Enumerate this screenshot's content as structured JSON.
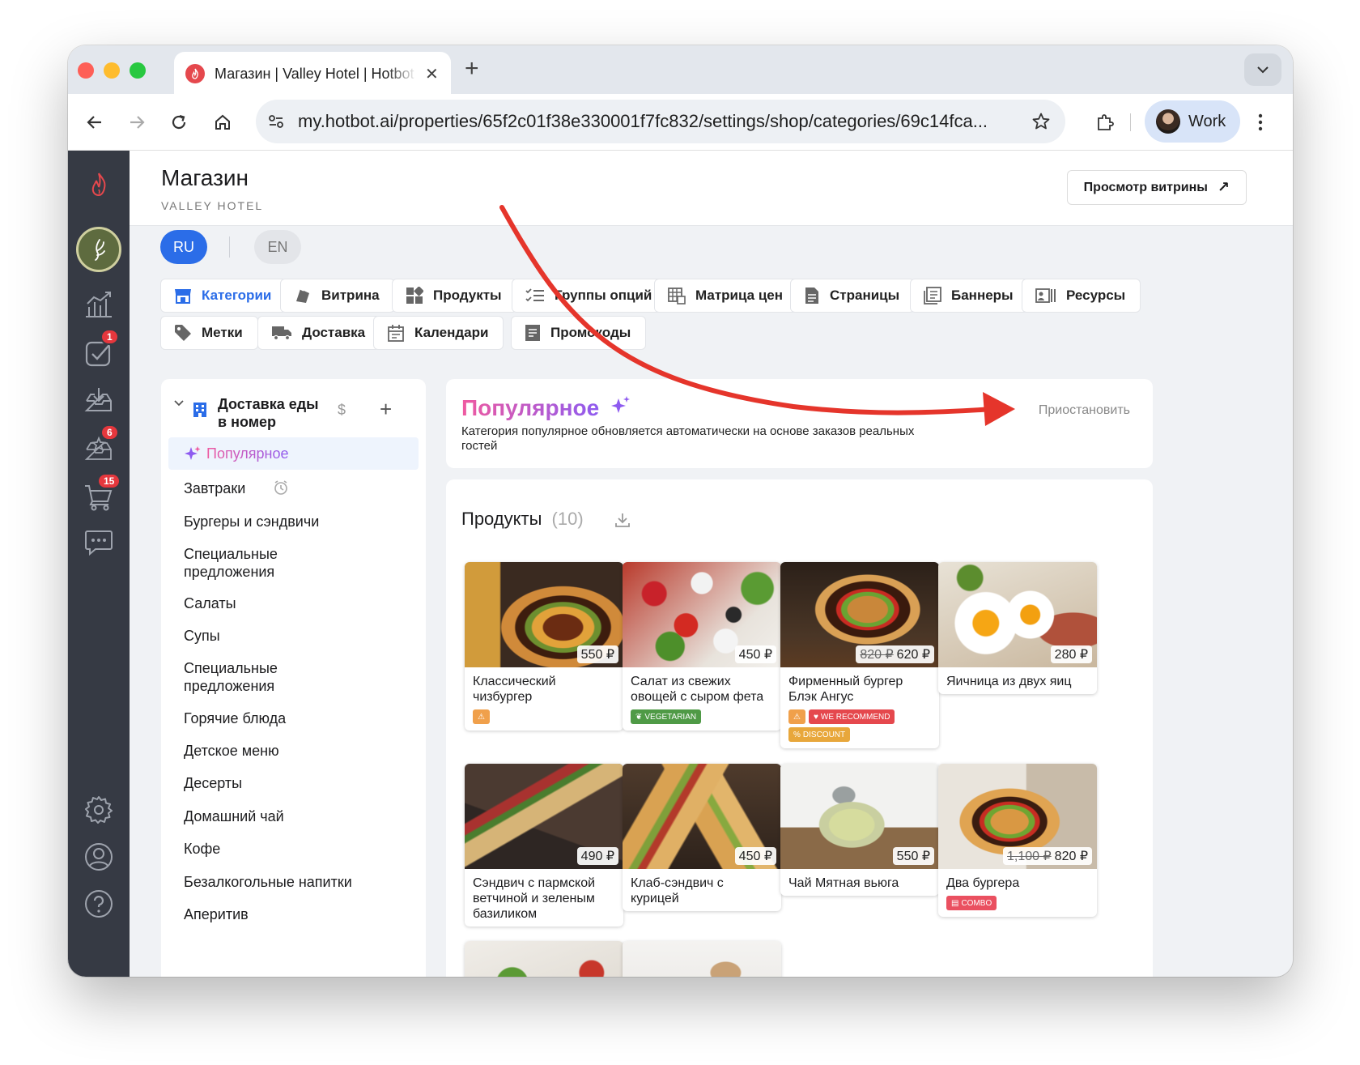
{
  "browser": {
    "tab_title": "Магазин | Valley Hotel | Hotbot",
    "tab_close": "✕",
    "new_tab": "+",
    "url": "my.hotbot.ai/properties/65f2c01f38e330001f7fc832/settings/shop/categories/69c14fca...",
    "profile": "Work"
  },
  "rail": {
    "badges": {
      "tasks": "1",
      "reviews": "6",
      "orders": "15"
    }
  },
  "header": {
    "title": "Магазин",
    "subtitle": "VALLEY HOTEL",
    "showcase_button": "Просмотр витрины",
    "showcase_icon": "↗"
  },
  "languages": [
    "RU",
    "EN"
  ],
  "nav_tabs": [
    {
      "label": "Категории",
      "icon": "store-icon"
    },
    {
      "label": "Витрина",
      "icon": "showcase-icon"
    },
    {
      "label": "Продукты",
      "icon": "grid-icon"
    },
    {
      "label": "Группы опций",
      "icon": "checklist-icon"
    },
    {
      "label": "Матрица цен",
      "icon": "table-icon"
    },
    {
      "label": "Страницы",
      "icon": "page-icon"
    },
    {
      "label": "Баннеры",
      "icon": "banner-icon"
    },
    {
      "label": "Ресурсы",
      "icon": "resources-icon"
    },
    {
      "label": "Метки",
      "icon": "tag-icon"
    },
    {
      "label": "Доставка",
      "icon": "truck-icon"
    },
    {
      "label": "Календари",
      "icon": "calendar-icon"
    },
    {
      "label": "Промокоды",
      "icon": "promo-icon"
    }
  ],
  "categories": {
    "group_title_line1": "Доставка еды",
    "group_title_line2": "в номер",
    "currency_icon": "$",
    "add_icon": "+",
    "popular": "Популярное",
    "items": [
      "Завтраки",
      "Бургеры и сэндвичи",
      "Специальные предложения",
      "Салаты",
      "Супы",
      "Специальные предложения",
      "Горячие блюда",
      "Детское меню",
      "Десерты",
      "Домашний чай",
      "Кофе",
      "Безалкогольные напитки",
      "Аперитив"
    ]
  },
  "popular_panel": {
    "title": "Популярное",
    "description_line1": "Категория популярное обновляется автоматически на основе заказов реальных",
    "description_line2": "гостей",
    "pause_button": "Приостановить"
  },
  "products": {
    "title": "Продукты",
    "count": "(10)",
    "items": [
      {
        "name": "Классический чизбургер",
        "price": "550 ₽",
        "old_price": ""
      },
      {
        "name": "Салат из свежих овощей с сыром фета",
        "price": "450 ₽",
        "old_price": ""
      },
      {
        "name": "Фирменный бургер Блэк Ангус",
        "price": "620 ₽",
        "old_price": "820 ₽"
      },
      {
        "name": "Яичница из двух яиц",
        "price": "280 ₽",
        "old_price": ""
      },
      {
        "name": "Сэндвич с пармской ветчиной и зеленым базиликом",
        "price": "490 ₽",
        "old_price": ""
      },
      {
        "name": "Клаб-сэндвич с курицей",
        "price": "450 ₽",
        "old_price": ""
      },
      {
        "name": "Чай Мятная вьюга",
        "price": "550 ₽",
        "old_price": ""
      },
      {
        "name": "Два бургера",
        "price": "820 ₽",
        "old_price": "1,100 ₽"
      }
    ],
    "tags": {
      "vegetarian": "VEGETARIAN",
      "recommend": "WE RECOMMEND",
      "discount": "DISCOUNT",
      "combo": "COMBO"
    }
  },
  "colors": {
    "accent": "#2b6de8",
    "sidebar": "#363a44",
    "annotation_arrow": "#e5352b",
    "popular_gradient_start": "#ef5aa0",
    "popular_gradient_end": "#8e5bf0",
    "badge": "#e5373d"
  }
}
